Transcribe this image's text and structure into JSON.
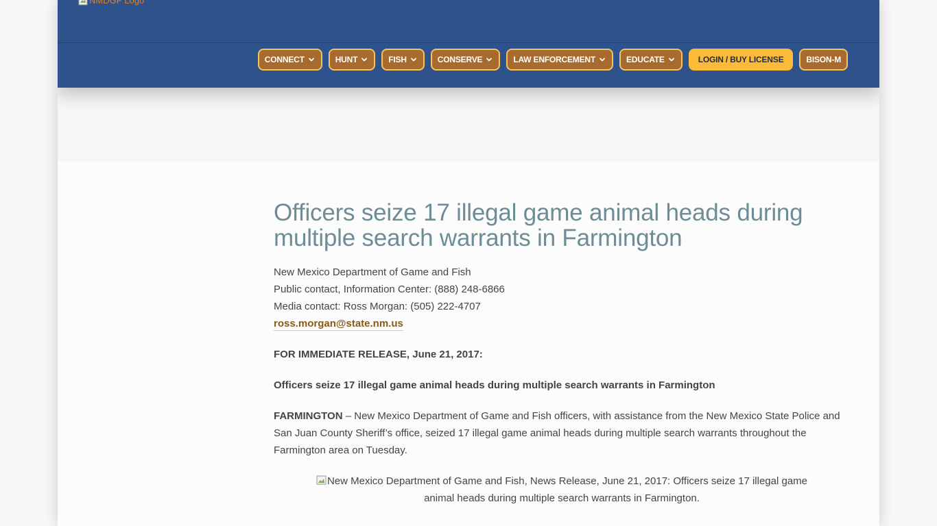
{
  "header": {
    "logo_alt": "NMDGF Logo",
    "nav": [
      {
        "label": "CONNECT",
        "dropdown": true
      },
      {
        "label": "HUNT",
        "dropdown": true
      },
      {
        "label": "FISH",
        "dropdown": true
      },
      {
        "label": "CONSERVE",
        "dropdown": true
      },
      {
        "label": "LAW ENFORCEMENT",
        "dropdown": true
      },
      {
        "label": "EDUCATE",
        "dropdown": true
      },
      {
        "label": "LOGIN / BUY LICENSE",
        "dropdown": false
      },
      {
        "label": "BISON-M",
        "dropdown": false
      }
    ]
  },
  "article": {
    "title": "Officers seize 17 illegal game animal heads during multiple search warrants in Farmington",
    "contact": {
      "org": "New Mexico Department of Game and Fish",
      "public": "Public contact, Information Center: (888) 248-6866",
      "media": "Media contact: Ross Morgan: (505) 222-4707",
      "email": "ross.morgan@state.nm.us"
    },
    "release": "FOR IMMEDIATE RELEASE, June 21, 2017:",
    "subtitle": "Officers seize 17 illegal game animal heads during multiple search warrants in Farmington",
    "dateline": "FARMINGTON",
    "body": " – New Mexico Department of Game and Fish officers, with assistance from the New Mexico State Police and San Juan County Sheriff’s office, seized 17 illegal game animal heads during multiple search warrants throughout the Farmington area on Tuesday.",
    "image_alt": "New Mexico Department of Game and Fish, News Release, June 21, 2017: Officers seize 17 illegal game animal heads during multiple search warrants in Farmington."
  },
  "colors": {
    "header_bg": "#2e538c",
    "nav_bg": "#a86a2d",
    "nav_border": "#f4c261",
    "primary_btn": "#fbbb39",
    "title": "#6e8c96",
    "link": "#8a5a14"
  },
  "icons": {
    "dropdown": "chevron-down-icon",
    "broken_image": "broken-image-icon"
  }
}
